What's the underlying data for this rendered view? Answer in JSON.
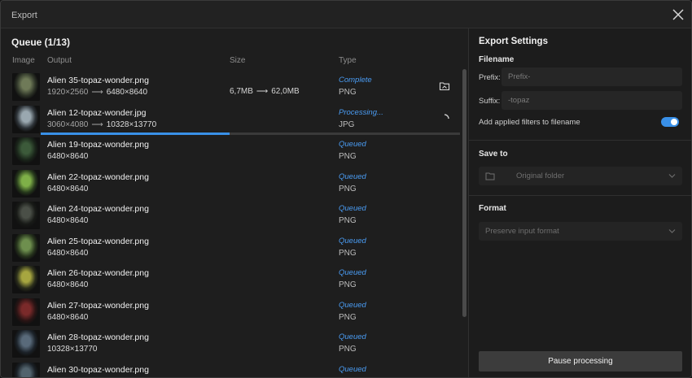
{
  "window": {
    "title": "Export",
    "close_icon": "close-icon"
  },
  "queue": {
    "title": "Queue (1/13)",
    "columns": {
      "image": "Image",
      "output": "Output",
      "size": "Size",
      "type": "Type"
    },
    "arrow": "⟶",
    "rows": [
      {
        "name": "Alien 35-topaz-wonder.png",
        "dims_from": "1920×2560",
        "dims_to": "6480×8640",
        "size_from": "6,7MB",
        "size_to": "62,0MB",
        "status": "Complete",
        "type": "PNG",
        "action": "open-folder-icon"
      },
      {
        "name": "Alien 12-topaz-wonder.jpg",
        "dims_from": "3060×4080",
        "dims_to": "10328×13770",
        "status": "Processing...",
        "type": "JPG",
        "action": "spinner-icon",
        "progress": 0.45
      },
      {
        "name": "Alien 19-topaz-wonder.png",
        "dims": "6480×8640",
        "status": "Queued",
        "type": "PNG"
      },
      {
        "name": "Alien 22-topaz-wonder.png",
        "dims": "6480×8640",
        "status": "Queued",
        "type": "PNG"
      },
      {
        "name": "Alien 24-topaz-wonder.png",
        "dims": "6480×8640",
        "status": "Queued",
        "type": "PNG"
      },
      {
        "name": "Alien 25-topaz-wonder.png",
        "dims": "6480×8640",
        "status": "Queued",
        "type": "PNG"
      },
      {
        "name": "Alien 26-topaz-wonder.png",
        "dims": "6480×8640",
        "status": "Queued",
        "type": "PNG"
      },
      {
        "name": "Alien 27-topaz-wonder.png",
        "dims": "6480×8640",
        "status": "Queued",
        "type": "PNG"
      },
      {
        "name": "Alien 28-topaz-wonder.png",
        "dims": "10328×13770",
        "status": "Queued",
        "type": "PNG"
      },
      {
        "name": "Alien 30-topaz-wonder.png",
        "dims": "",
        "status": "Queued",
        "type": ""
      }
    ]
  },
  "settings": {
    "title": "Export Settings",
    "filename": {
      "label": "Filename",
      "prefix_label": "Prefix:",
      "prefix_placeholder": "Prefix-",
      "suffix_label": "Suffix:",
      "suffix_placeholder": "-topaz",
      "toggle_label": "Add applied filters to filename",
      "toggle_on": true
    },
    "save_to": {
      "label": "Save to",
      "value": "Original folder",
      "icon": "folder-icon"
    },
    "format": {
      "label": "Format",
      "value": "Preserve input format"
    },
    "pause_label": "Pause processing"
  },
  "colors": {
    "accent": "#3990e8",
    "status_blue": "#4a9cf3"
  },
  "thumb_colors": [
    [
      "#6f7a58",
      "#2d3327"
    ],
    [
      "#9aa8b0",
      "#2d3338"
    ],
    [
      "#3c5a3a",
      "#1a251a"
    ],
    [
      "#7fb048",
      "#273a1c"
    ],
    [
      "#4a4f47",
      "#181a17"
    ],
    [
      "#6e8f4e",
      "#26331c"
    ],
    [
      "#a7a640",
      "#2b2e1b"
    ],
    [
      "#7a2a2a",
      "#2a1414"
    ],
    [
      "#596a7a",
      "#1c232a"
    ],
    [
      "#52636d",
      "#1a2026"
    ]
  ]
}
